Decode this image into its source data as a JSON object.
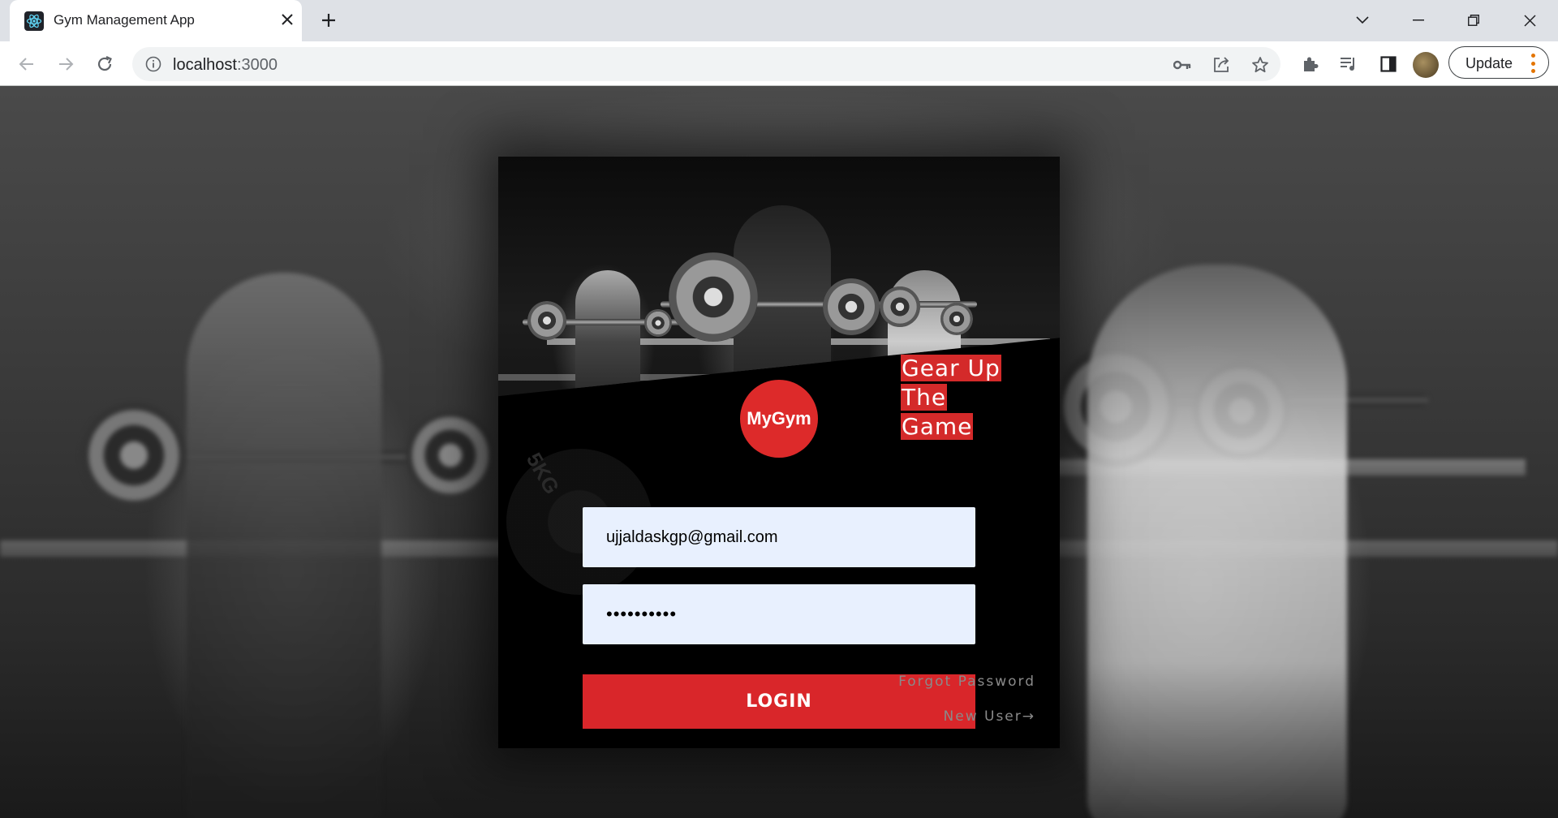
{
  "browser": {
    "tab_title": "Gym Management App",
    "new_tab_symbol": "+",
    "close_symbol": "✕",
    "url_host": "localhost",
    "url_port": ":3000",
    "update_label": "Update"
  },
  "page": {
    "logo_text": "MyGym",
    "tagline_line1": "Gear Up The",
    "tagline_line2": "Game",
    "email_value": "ujjaldaskgp@gmail.com",
    "password_value": "••••••••••",
    "login_label": "LOGIN",
    "forgot_label": "Forgot Password",
    "new_user_label": "New User→",
    "plate_text": "5KG"
  },
  "colors": {
    "accent_red": "#d9262a",
    "input_bg": "#e8f0fe"
  }
}
